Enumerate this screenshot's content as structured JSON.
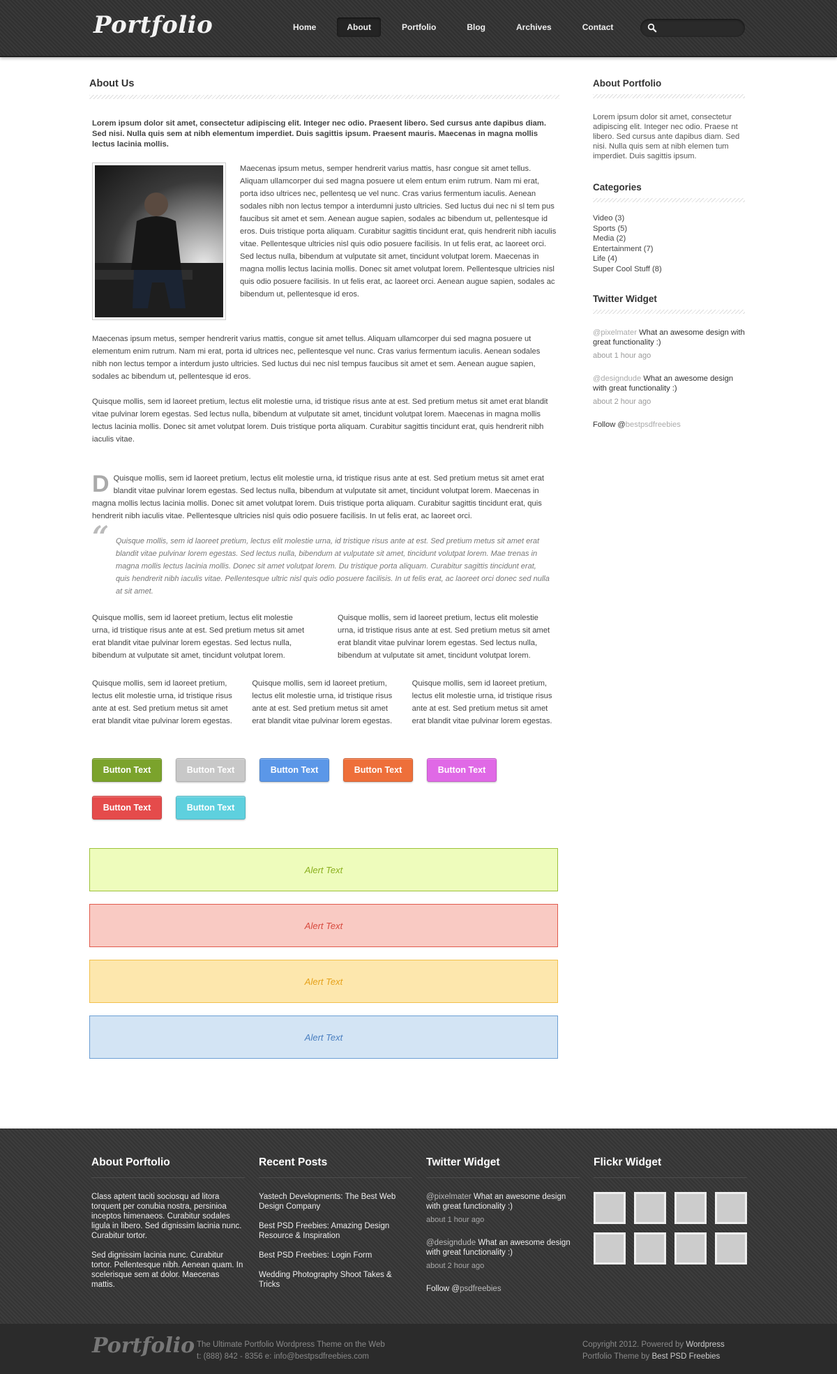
{
  "header": {
    "logo": "Portfolio",
    "nav": [
      "Home",
      "About",
      "Portfolio",
      "Blog",
      "Archives",
      "Contact"
    ],
    "active_nav": "About",
    "search_placeholder": ""
  },
  "main": {
    "title": "About Us",
    "intro": "Lorem ipsum dolor sit amet, consectetur adipiscing elit. Integer nec odio. Praesent libero. Sed cursus ante dapibus diam. Sed nisi. Nulla quis sem at nibh elementum imperdiet. Duis sagittis ipsum. Praesent mauris. Maecenas in magna mollis lectus lacinia mollis.",
    "media_text": "Maecenas ipsum metus, semper hendrerit varius mattis, hasr congue sit amet tellus. Aliquam ullamcorper dui sed magna posuere ut elem entum enim rutrum. Nam mi erat, porta idso ultrices nec, pellentesq ue vel nunc. Cras varius fermentum iaculis. Aenean sodales nibh non lectus tempor a interdumni justo ultricies. Sed luctus dui nec ni sl tem pus faucibus sit amet et sem. Aenean augue sapien, sodales ac bibendum ut, pellentesque id eros. Duis tristique porta aliquam. Curabitur sagittis tincidunt erat, quis hendrerit nibh iaculis vitae. Pellentesque ultricies nisl quis odio posuere facilisis. In ut felis erat, ac laoreet orci. Sed lectus nulla, bibendum at vulputate sit amet, tincidunt volutpat lorem. Maecenas in magna mollis lectus lacinia mollis. Donec sit amet volutpat lorem. Pellentesque ultricies nisl quis odio posuere facilisis. In ut felis erat, ac laoreet orci. Aenean augue sapien, sodales ac bibendum ut, pellentesque id eros.",
    "para1": "Maecenas ipsum metus, semper hendrerit varius mattis, congue sit amet tellus. Aliquam ullamcorper dui sed magna posuere ut elementum enim rutrum. Nam mi erat, porta id ultrices nec, pellentesque vel nunc. Cras varius fermentum iaculis. Aenean sodales nibh non lectus tempor a interdum justo ultricies. Sed luctus dui nec nisl tempus faucibus sit amet et sem. Aenean augue sapien, sodales ac bibendum ut, pellentesque id eros.",
    "para2": "Quisque mollis, sem id laoreet pretium, lectus elit molestie urna, id tristique risus ante at est. Sed pretium metus sit amet erat blandit vitae pulvinar lorem egestas. Sed lectus nulla, bibendum at vulputate sit amet, tincidunt volutpat lorem. Maecenas in magna mollis lectus lacinia mollis. Donec sit amet volutpat lorem. Duis tristique porta aliquam. Curabitur sagittis tincidunt erat, quis hendrerit nibh iaculis vitae.",
    "dropcap_letter": "D",
    "dropcap_text": "Quisque mollis, sem id laoreet pretium, lectus elit molestie urna, id tristique risus ante at est. Sed pretium metus sit amet erat blandit vitae pulvinar lorem egestas. Sed lectus nulla, bibendum at vulputate sit amet, tincidunt volutpat lorem. Maecenas in magna mollis lectus lacinia mollis. Donec sit amet volutpat lorem. Duis tristique porta aliquam. Curabitur sagittis tincidunt erat, quis hendrerit nibh iaculis vitae. Pellentesque ultricies nisl quis odio posuere facilisis. In ut felis erat, ac laoreet orci.",
    "quote_mark": "“",
    "quote": "Quisque mollis, sem id laoreet pretium, lectus elit molestie urna, id tristique risus ante at est. Sed pretium metus sit amet erat blandit vitae pulvinar lorem egestas. Sed lectus nulla, bibendum at vulputate sit amet, tincidunt volutpat lorem. Mae trenas in magna mollis lectus lacinia mollis. Donec sit amet volutpat lorem. Du tristique porta aliquam. Curabitur sagittis tincidunt erat, quis hendrerit nibh iaculis vitae. Pellentesque ultric nisl quis odio posuere facilisis. In ut felis erat, ac laoreet orci donec sed nulla at sit amet.",
    "col2_a": "Quisque mollis, sem id laoreet pretium, lectus elit molestie urna, id tristique risus ante at est. Sed pretium metus sit amet erat blandit vitae pulvinar lorem egestas. Sed lectus nulla, bibendum at vulputate sit amet, tincidunt volutpat lorem.",
    "col2_b": "Quisque mollis, sem id laoreet pretium, lectus elit molestie urna, id tristique risus ante at est. Sed pretium metus sit amet erat blandit vitae pulvinar lorem egestas. Sed lectus nulla, bibendum at vulputate sit amet, tincidunt volutpat lorem.",
    "col3_a": "Quisque mollis, sem id laoreet pretium, lectus elit molestie urna, id tristique risus ante at est. Sed pretium metus sit amet erat blandit vitae pulvinar lorem egestas.",
    "col3_b": "Quisque mollis, sem id laoreet pretium, lectus elit molestie urna, id tristique risus ante at est. Sed pretium metus sit amet erat blandit vitae pulvinar lorem egestas.",
    "col3_c": "Quisque mollis, sem id laoreet pretium, lectus elit molestie urna, id tristique risus ante at est. Sed pretium metus sit amet erat blandit vitae pulvinar lorem egestas.",
    "buttons": [
      {
        "label": "Button Text",
        "color": "#7ba32c"
      },
      {
        "label": "Button Text",
        "color": "#c8c8c8"
      },
      {
        "label": "Button Text",
        "color": "#5b97e8"
      },
      {
        "label": "Button Text",
        "color": "#ee6f3a"
      },
      {
        "label": "Button Text",
        "color": "#e069e6"
      },
      {
        "label": "Button Text",
        "color": "#e54b4b"
      },
      {
        "label": "Button Text",
        "color": "#5ed0de"
      }
    ],
    "alerts": [
      {
        "label": "Alert Text",
        "bg": "#eefcbc",
        "border": "#9dc23a",
        "color": "#8bb01f"
      },
      {
        "label": "Alert Text",
        "bg": "#f9cac3",
        "border": "#e15a4c",
        "color": "#d84a3e"
      },
      {
        "label": "Alert Text",
        "bg": "#fde7ad",
        "border": "#f2c04a",
        "color": "#e6a21a"
      },
      {
        "label": "Alert Text",
        "bg": "#d3e4f4",
        "border": "#6c9fd4",
        "color": "#4a7fc0"
      }
    ]
  },
  "sidebar": {
    "about_title": "About Portfolio",
    "about_text": "Lorem ipsum dolor sit amet, consectetur adipiscing elit. Integer nec odio. Praese nt libero. Sed cursus ante dapibus diam. Sed nisi. Nulla quis sem at nibh elemen tum imperdiet. Duis sagittis ipsum.",
    "categories_title": "Categories",
    "categories": [
      "Video (3)",
      "Sports (5)",
      "Media (2)",
      "Entertainment (7)",
      "Life (4)",
      "Super Cool Stuff (8)"
    ],
    "twitter_title": "Twitter Widget",
    "tweets": [
      {
        "at": "@",
        "handle": "pixelmater",
        "text": " What an awesome design with great functionality :)",
        "time": "about 1 hour ago"
      },
      {
        "at": "@",
        "handle": "designdude",
        "text": " What an awesome design with great functionality :)",
        "time": "about 2 hour ago"
      }
    ],
    "follow_label": "Follow @",
    "follow_handle": "bestpsdfreebies"
  },
  "footer": {
    "about_title": "About Porftolio",
    "about_p1": "Class aptent taciti sociosqu ad litora torquent per conubia nostra, persinioa inceptos himenaeos. Curabitur sodales ligula in libero. Sed dignissim lacinia nunc. Curabitur tortor.",
    "about_p2": "Sed dignissim lacinia nunc. Curabitur tortor. Pellentesque nibh. Aenean quam. In scelerisque sem at dolor. Maecenas mattis.",
    "posts_title": "Recent Posts",
    "posts": [
      "Yastech Developments: The Best Web Design Company",
      "Best PSD Freebies: Amazing Design Resource & Inspiration",
      "Best PSD Freebies: Login Form",
      "Wedding Photography Shoot Takes & Tricks"
    ],
    "twitter_title": "Twitter Widget",
    "tweets": [
      {
        "handle": "@pixelmater",
        "text": " What an awesome design with great functionality :)",
        "time": "about 1 hour ago"
      },
      {
        "handle": "@designdude",
        "text": " What an awesome design with great functionality :)",
        "time": "about 2 hour ago"
      }
    ],
    "follow_label": "Follow @",
    "follow_handle": "psdfreebies",
    "flickr_title": "Flickr Widget",
    "logo": "Portfolio",
    "tagline": "The Ultimate Portfolio  Wordpress Theme on the Web",
    "contact": "t: (888) 842 - 8356  e: info@bestpsdfreebies.com",
    "copyright_prefix": "Copyright 2012. Powered by ",
    "copyright_link": "Wordpress",
    "theme_prefix": "Portfolio Theme by ",
    "theme_link": "Best PSD Freebies"
  }
}
